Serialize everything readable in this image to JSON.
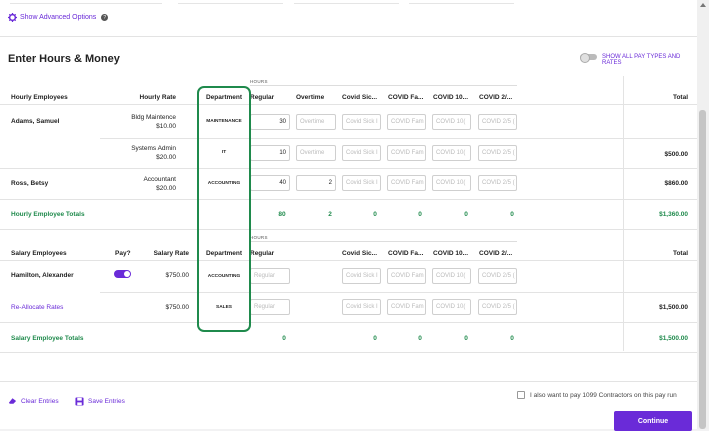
{
  "advanced": {
    "label": "Show Advanced Options"
  },
  "section": {
    "title": "Enter Hours & Money",
    "show_all": "SHOW ALL PAY TYPES AND RATES"
  },
  "hours_label": "HOURS",
  "hourly": {
    "headers": {
      "employee": "Hourly Employees",
      "rate": "Hourly Rate",
      "department": "Department",
      "regular": "Regular",
      "overtime": "Overtime",
      "sick": "Covid Sic...",
      "family": "COVID Fa...",
      "c10": "COVID 10...",
      "c2": "COVID 2/...",
      "total": "Total"
    },
    "rows": [
      {
        "name": "Adams, Samuel",
        "rate_title": "Bldg Maintence",
        "rate": "$10.00",
        "department": "MAINTENANCE",
        "regular": "30",
        "overtime_ph": "Overtime",
        "sick_ph": "Covid Sick I",
        "family_ph": "COVID Fam",
        "c10_ph": "COVID 10(",
        "c2_ph": "COVID 2/5 (",
        "total": ""
      },
      {
        "name": "",
        "rate_title": "Systems Admin",
        "rate": "$20.00",
        "department": "IT",
        "regular": "10",
        "overtime_ph": "Overtime",
        "sick_ph": "Covid Sick I",
        "family_ph": "COVID Fam",
        "c10_ph": "COVID 10(",
        "c2_ph": "COVID 2/5 (",
        "total": "$500.00"
      },
      {
        "name": "Ross, Betsy",
        "rate_title": "Accountant",
        "rate": "$20.00",
        "department": "ACCOUNTING",
        "regular": "40",
        "overtime": "2",
        "sick_ph": "Covid Sick I",
        "family_ph": "COVID Fam",
        "c10_ph": "COVID 10(",
        "c2_ph": "COVID 2/5 (",
        "total": "$860.00"
      }
    ],
    "totals": {
      "label": "Hourly Employee Totals",
      "regular": "80",
      "overtime": "2",
      "sick": "0",
      "family": "0",
      "c10": "0",
      "c2": "0",
      "total": "$1,360.00"
    }
  },
  "salary": {
    "headers": {
      "employee": "Salary Employees",
      "pay": "Pay?",
      "rate": "Salary Rate",
      "department": "Department",
      "regular": "Regular",
      "sick": "Covid Sic...",
      "family": "COVID Fa...",
      "c10": "COVID 10...",
      "c2": "COVID 2/...",
      "total": "Total"
    },
    "rows": [
      {
        "name": "Hamilton, Alexander",
        "pay": true,
        "rate": "$750.00",
        "department": "ACCOUNTING",
        "regular_ph": "Regular",
        "sick_ph": "Covid Sick I",
        "family_ph": "COVID Fam",
        "c10_ph": "COVID 10(",
        "c2_ph": "COVID 2/5 (",
        "total": ""
      },
      {
        "name": "Re-Allocate Rates",
        "rate": "$750.00",
        "department": "SALES",
        "regular_ph": "Regular",
        "sick_ph": "Covid Sick I",
        "family_ph": "COVID Fam",
        "c10_ph": "COVID 10(",
        "c2_ph": "COVID 2/5 (",
        "total": "$1,500.00"
      }
    ],
    "totals": {
      "label": "Salary Employee Totals",
      "regular": "0",
      "sick": "0",
      "family": "0",
      "c10": "0",
      "c2": "0",
      "total": "$1,500.00"
    }
  },
  "footer": {
    "clear": "Clear Entries",
    "save": "Save Entries",
    "contractors": "I also want to pay 1099 Contractors on this pay run",
    "continue": "Continue"
  },
  "colors": {
    "accent": "#6a2bd8",
    "green": "#1f8a4c"
  }
}
